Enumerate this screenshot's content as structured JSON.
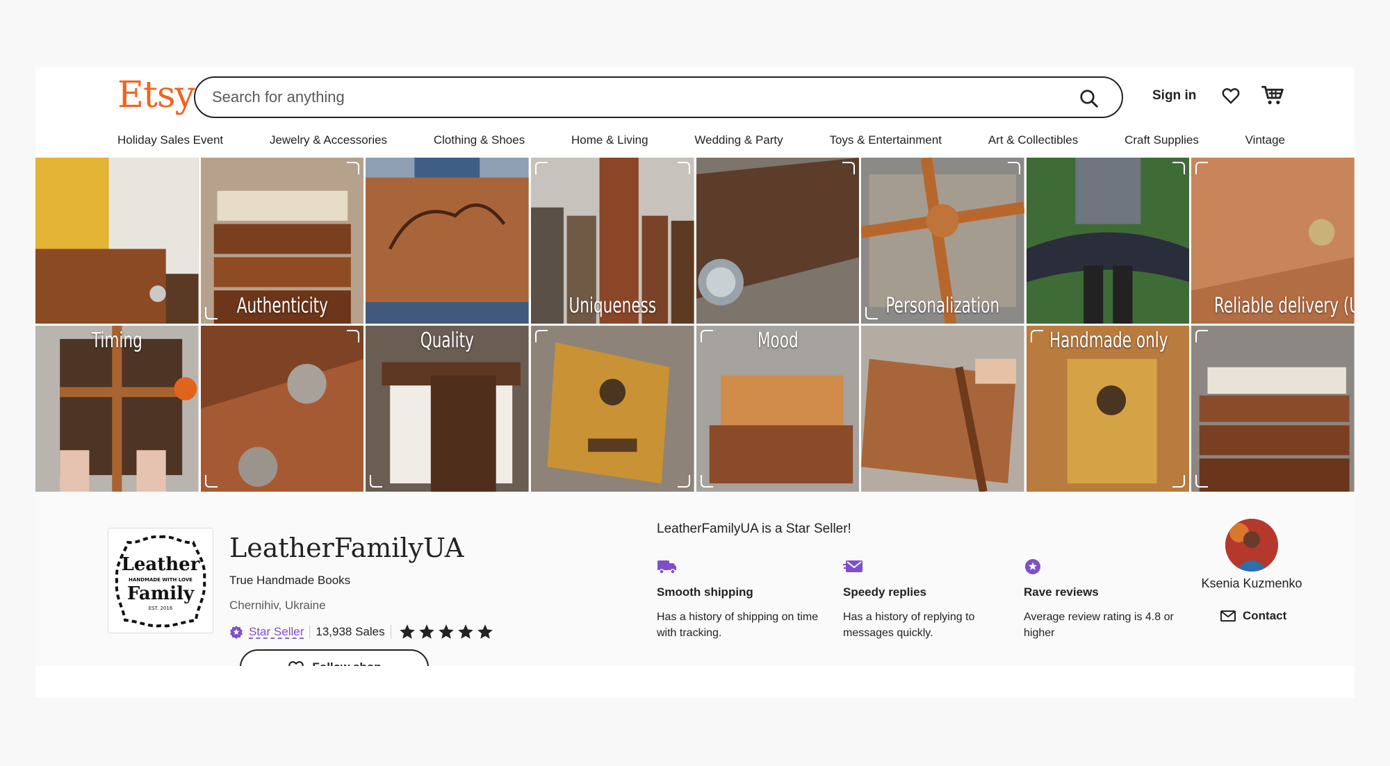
{
  "header": {
    "logo": "Etsy",
    "search_placeholder": "Search for anything",
    "sign_in": "Sign in",
    "icons": [
      "search-icon",
      "heart-icon",
      "cart-icon"
    ],
    "nav": [
      "Holiday Sales Event",
      "Jewelry & Accessories",
      "Clothing & Shoes",
      "Home & Living",
      "Wedding & Party",
      "Toys & Entertainment",
      "Art & Collectibles",
      "Craft Supplies",
      "Vintage"
    ]
  },
  "banner": {
    "words": [
      "Authenticity",
      "Uniqueness",
      "Personalization",
      "Reliable delivery (UP",
      "Timing",
      "Quality",
      "Mood",
      "Handmade only"
    ]
  },
  "shop": {
    "name": "LeatherFamilyUA",
    "tagline": "True Handmade Books",
    "location": "Chernihiv, Ukraine",
    "star_seller_label": "Star Seller",
    "sales": "13,938 Sales",
    "rating_stars": 5,
    "follow_label": "Follow shop",
    "logo_text": {
      "line1": "Leather",
      "line2": "HANDMADE WITH LOVE",
      "line3": "Family",
      "line4": "EST. 2016"
    }
  },
  "star_seller": {
    "heading": "LeatherFamilyUA is a Star Seller!",
    "features": [
      {
        "icon": "truck-icon",
        "title": "Smooth shipping",
        "desc": "Has a history of shipping on time with tracking."
      },
      {
        "icon": "message-icon",
        "title": "Speedy replies",
        "desc": "Has a history of replying to messages quickly."
      },
      {
        "icon": "star-badge-icon",
        "title": "Rave reviews",
        "desc": "Average review rating is 4.8 or higher"
      }
    ]
  },
  "owner": {
    "name": "Ksenia Kuzmenko",
    "contact_label": "Contact"
  },
  "colors": {
    "accent": "#f1641e",
    "star_seller": "#7f4fc9",
    "leather": "#8a4a22"
  }
}
